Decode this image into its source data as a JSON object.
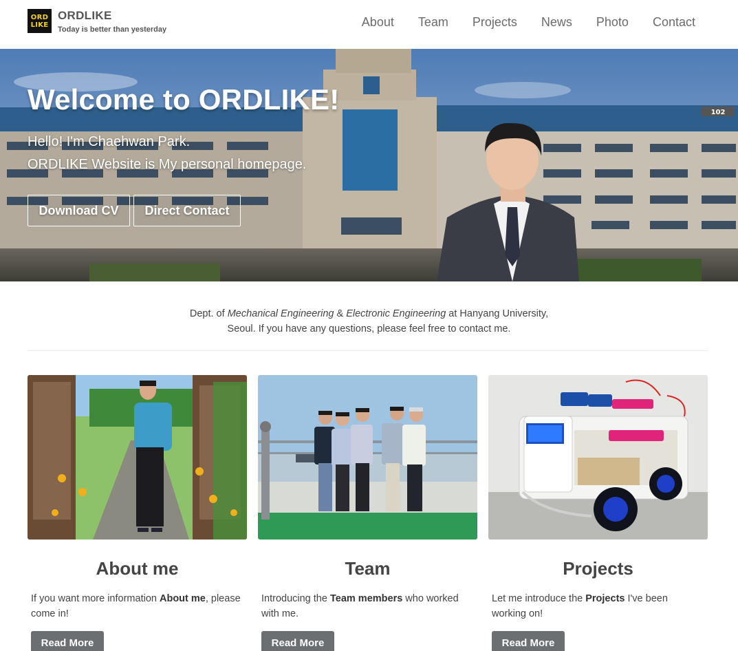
{
  "header": {
    "logo_line1": "ORD",
    "logo_line2": "LIKE",
    "brand": "ORDLIKE",
    "tagline": "Today is better than yesterday",
    "nav": [
      "About",
      "Team",
      "Projects",
      "News",
      "Photo",
      "Contact"
    ]
  },
  "hero": {
    "title": "Welcome to ORDLIKE!",
    "line1": "Hello! I'm Chaehwan Park.",
    "line2": "ORDLIKE Website is My personal homepage.",
    "download_cv": "Download CV",
    "direct_contact": "Direct Contact",
    "building_number": "102"
  },
  "intro": {
    "prefix": "Dept. of ",
    "field1": "Mechanical Engineering",
    "amp": " & ",
    "field2": "Electronic Engineering",
    "suffix": " at Hanyang University,",
    "line2": "Seoul. If you have any questions, please feel free to contact me."
  },
  "cards": [
    {
      "title": "About me",
      "pre": "If you want more information ",
      "bold": "About me",
      "post": ", please come in!",
      "button": "Read More"
    },
    {
      "title": "Team",
      "pre": "Introducing the ",
      "bold": "Team members",
      "post": " who worked with me.",
      "button": "Read More"
    },
    {
      "title": "Projects",
      "pre": "Let me introduce the ",
      "bold": "Projects",
      "post": " I've been working on!",
      "button": "Read More"
    }
  ]
}
